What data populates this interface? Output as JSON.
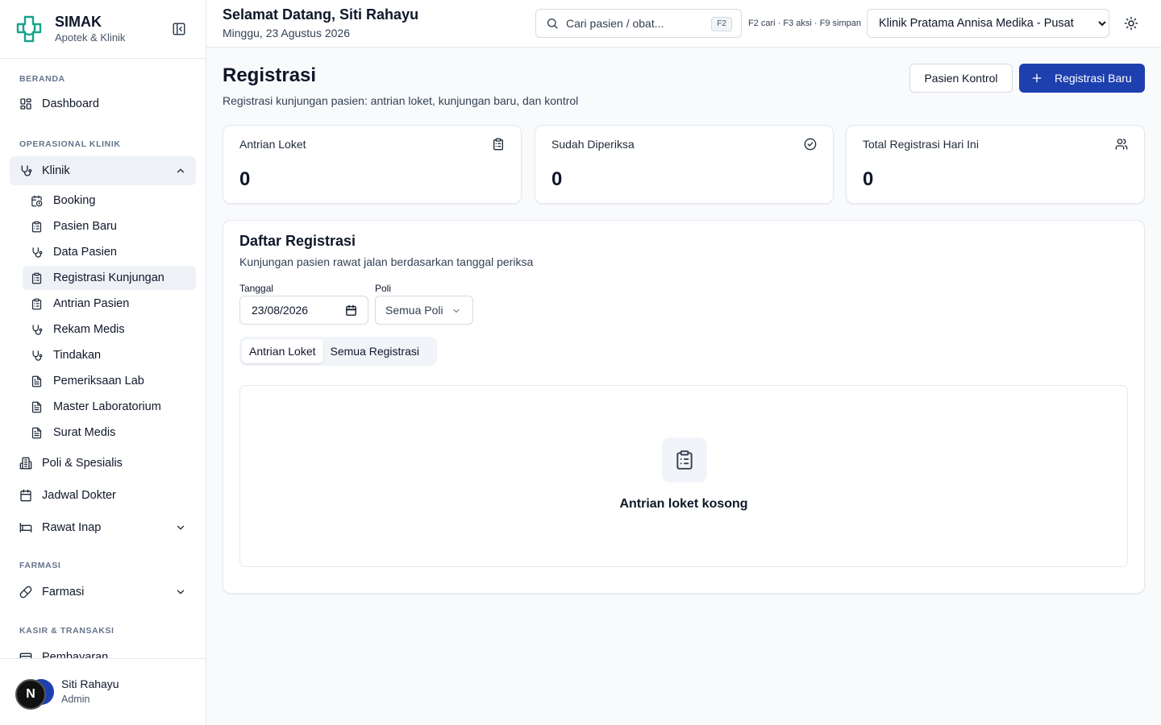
{
  "brand": {
    "name": "SIMAK",
    "subtitle": "Apotek & Klinik"
  },
  "sidebar": {
    "sections": {
      "beranda": "BERANDA",
      "operasional": "OPERASIONAL KLINIK",
      "farmasi": "FARMASI",
      "kasir": "KASIR & TRANSAKSI"
    },
    "dashboard": "Dashboard",
    "klinik": "Klinik",
    "klinik_items": [
      "Booking",
      "Pasien Baru",
      "Data Pasien",
      "Registrasi Kunjungan",
      "Antrian Pasien",
      "Rekam Medis",
      "Tindakan",
      "Pemeriksaan Lab",
      "Master Laboratorium",
      "Surat Medis"
    ],
    "poli": "Poli & Spesialis",
    "jadwal": "Jadwal Dokter",
    "rawat_inap": "Rawat Inap",
    "farmasi": "Farmasi",
    "pembayaran": "Pembayaran"
  },
  "user": {
    "initial": "N",
    "name": "Siti Rahayu",
    "role": "Admin"
  },
  "header": {
    "greeting": "Selamat Datang, Siti Rahayu",
    "date": "Minggu, 23 Agustus 2026",
    "search_placeholder": "Cari pasien / obat...",
    "search_key": "F2",
    "shortcuts": "F2 cari · F3 aksi · F9 simpan",
    "clinic": "Klinik Pratama Annisa Medika - Pusat"
  },
  "page": {
    "title": "Registrasi",
    "subtitle": "Registrasi kunjungan pasien: antrian loket, kunjungan baru, dan kontrol",
    "btn_kontrol": "Pasien Kontrol",
    "btn_baru": "Registrasi Baru"
  },
  "stats": [
    {
      "label": "Antrian Loket",
      "value": "0",
      "icon": "clipboard-icon"
    },
    {
      "label": "Sudah Diperiksa",
      "value": "0",
      "icon": "check-circle-icon"
    },
    {
      "label": "Total Registrasi Hari Ini",
      "value": "0",
      "icon": "users-icon"
    }
  ],
  "list": {
    "title": "Daftar Registrasi",
    "subtitle": "Kunjungan pasien rawat jalan berdasarkan tanggal periksa",
    "date_label": "Tanggal",
    "date_value": "23/08/2026",
    "poli_label": "Poli",
    "poli_value": "Semua Poli",
    "tabs": [
      "Antrian Loket",
      "Semua Registrasi"
    ],
    "empty_text": "Antrian loket kosong"
  },
  "colors": {
    "primary": "#1e40af",
    "brand": "#16a38a"
  }
}
